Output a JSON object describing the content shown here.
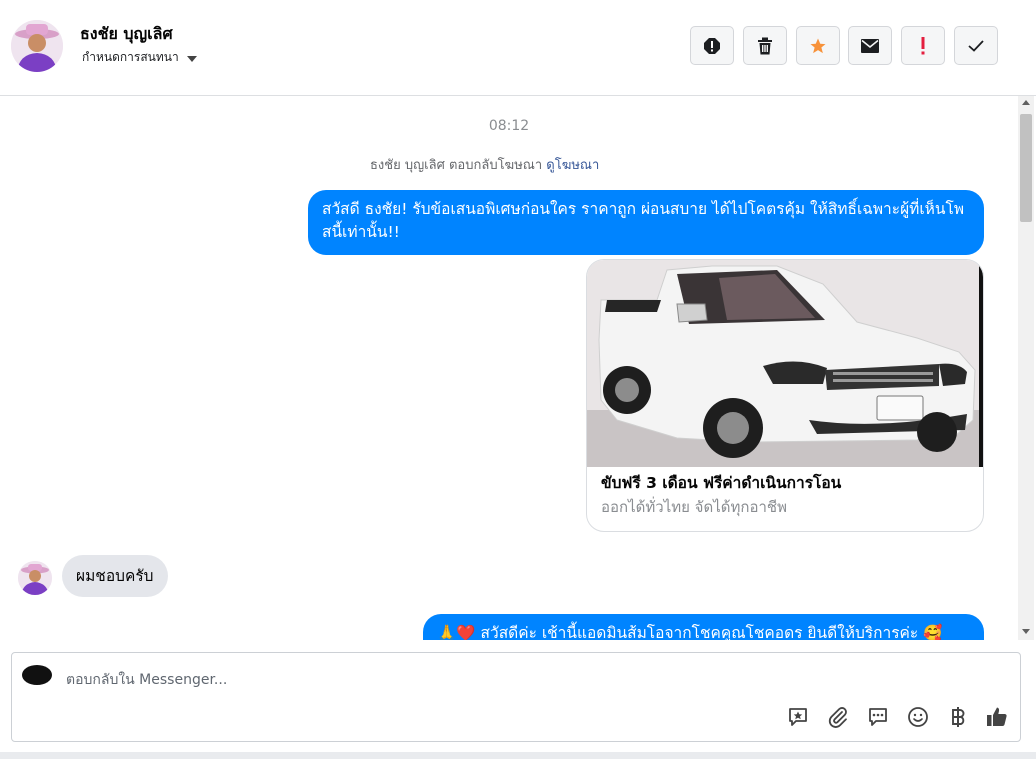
{
  "header": {
    "name": "ธงชัย บุญเลิศ",
    "assign_label": "กำหนดการสนทนา",
    "toolbar": [
      "alert-icon",
      "trash-icon",
      "star-icon",
      "envelope-icon",
      "exclamation-icon",
      "check-icon"
    ]
  },
  "conversation": {
    "timestamp": "08:12",
    "ad_reply_text": "ธงชัย บุญเลิศ ตอบกลับโฆษณา",
    "ad_view_link": "ดูโฆษณา",
    "out_message_1": "สวัสดี ธงชัย! รับข้อเสนอพิเศษก่อนใคร ราคาถูก ผ่อนสบาย ได้ไปโคตรคุ้ม ให้สิทธิ์เฉพาะผู้ที่เห็นโพสนี้เท่านั้น!!",
    "card": {
      "title": "ขับฟรี 3 เดือน ฟรีค่าดำเนินการโอน",
      "subtitle": "ออกได้ทั่วไทย จัดได้ทุกอาชีพ"
    },
    "in_message": "ผมชอบครับ",
    "out_message_2": "🙏❤️ สวัสดีค่ะ เช้านี้แอดมินส้มโอจากโชคคูณโชคอดร ยินดีให้บริการค่ะ 🥰"
  },
  "composer": {
    "placeholder": "ตอบกลับใน Messenger...",
    "icons": [
      "saved-reply-icon",
      "attachment-icon",
      "chat-icon",
      "emoji-icon",
      "baht-icon",
      "like-icon"
    ]
  },
  "colors": {
    "accent": "#0084ff",
    "incoming_bubble": "#e4e6eb",
    "star": "#f7923a",
    "exclamation": "#e41e3f"
  }
}
